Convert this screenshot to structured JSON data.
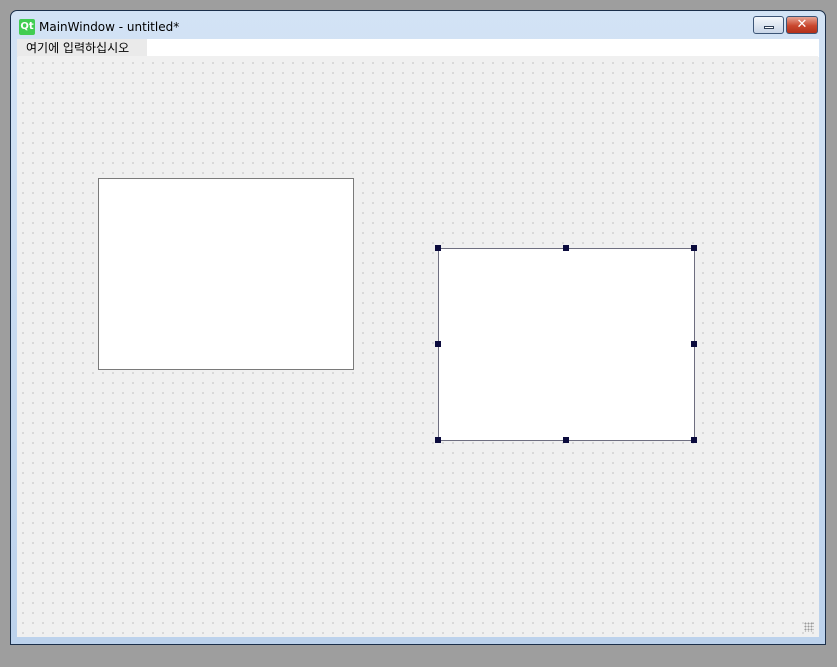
{
  "window": {
    "title": "MainWindow - untitled*",
    "icon_label": "Qt",
    "minimize_icon": "minimize-icon",
    "close_icon": "close-icon",
    "close_glyph": "✕"
  },
  "menubar": {
    "items": [
      {
        "label": "여기에 입력하십시오"
      }
    ]
  },
  "form": {
    "frames": [
      {
        "name": "frame-1",
        "selected": false
      },
      {
        "name": "frame-2",
        "selected": true
      }
    ]
  },
  "colors": {
    "selection_handle": "#0b0b3d",
    "close_button": "#c9472e",
    "qt_logo": "#41cd52"
  }
}
